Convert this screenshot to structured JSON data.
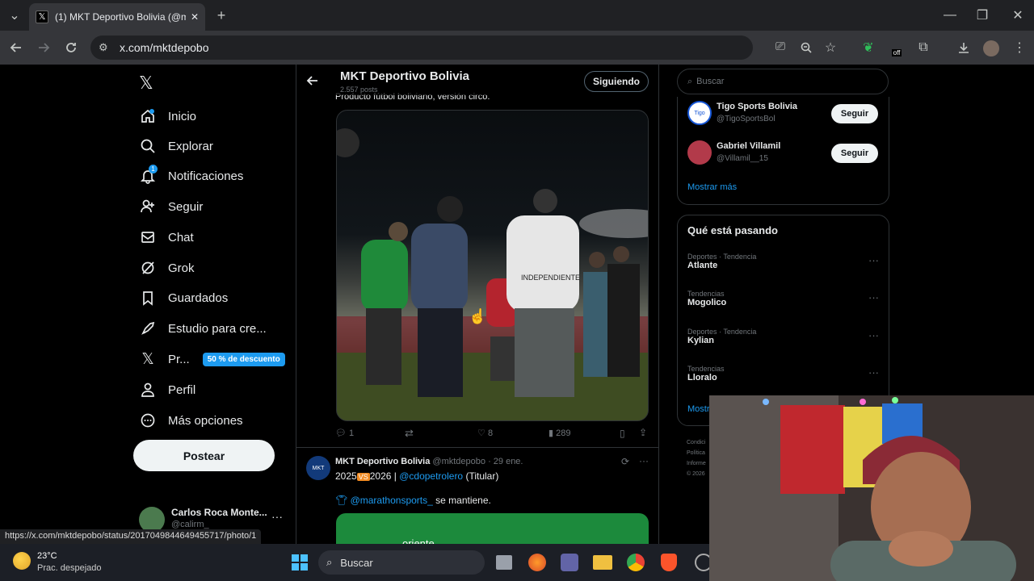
{
  "browser": {
    "tab_title": "(1) MKT Deportivo Bolivia (@mk",
    "tab_close": "✕",
    "new_tab": "+",
    "url": "x.com/mktdepobo",
    "status_url": "https://x.com/mktdepobo/status/2017049844649455717/photo/1",
    "window_min": "—",
    "window_max": "❐",
    "window_close": "✕",
    "ext_off_badge": "off"
  },
  "sidebar": {
    "items": [
      {
        "label": "Inicio"
      },
      {
        "label": "Explorar"
      },
      {
        "label": "Notificaciones"
      },
      {
        "label": "Seguir"
      },
      {
        "label": "Chat"
      },
      {
        "label": "Grok"
      },
      {
        "label": "Guardados"
      },
      {
        "label": "Estudio para cre..."
      },
      {
        "label": "Pr..."
      },
      {
        "label": "Perfil"
      },
      {
        "label": "Más opciones"
      }
    ],
    "premium_badge": "50 % de descuento",
    "notif_count": "1",
    "post_label": "Postear",
    "account_name": "Carlos Roca Monte...",
    "account_handle": "@calirm_"
  },
  "header": {
    "title": "MKT Deportivo Bolivia",
    "posts": "2.557 posts",
    "following_label": "Siguiendo",
    "cut_text": "Producto fútbol boliviano, versión circo."
  },
  "tweet1": {
    "replies": "1",
    "likes": "8",
    "views": "289",
    "jersey_text": "INDEPENDIENTE"
  },
  "tweet2": {
    "name": "MKT Deportivo Bolivia",
    "handle": "@mktdepobo",
    "date": "· 29 ene.",
    "line1_a": "2025",
    "line1_vs": "VS",
    "line1_b": "2026 |",
    "line1_mention": "@cdopetrolero",
    "line1_tail": "(Titular)",
    "line2_mention": "@marathonsports_",
    "line2_tail": "se mantiene.",
    "card_text": "oriente"
  },
  "right": {
    "search_placeholder": "Buscar",
    "suggestions": [
      {
        "name": "Tigo Sports Bolivia",
        "handle": "@TigoSportsBol",
        "button": "Seguir"
      },
      {
        "name": "Gabriel Villamil",
        "handle": "@Villamil__15",
        "button": "Seguir"
      }
    ],
    "show_more": "Mostrar más",
    "trends_title": "Qué está pasando",
    "trends": [
      {
        "category": "Deportes · Tendencia",
        "name": "Atlante"
      },
      {
        "category": "Tendencias",
        "name": "Mogolico"
      },
      {
        "category": "Deportes · Tendencia",
        "name": "Kylian"
      },
      {
        "category": "Tendencias",
        "name": "Lloralo"
      }
    ],
    "show_more_2": "Mostr",
    "footer_lines": [
      "Condici",
      "Política",
      "Informe",
      "© 2026"
    ]
  },
  "taskbar": {
    "temp": "23°C",
    "weather": "Prac. despejado",
    "search": "Buscar"
  },
  "colors": {
    "accent": "#1d9bf0",
    "bg": "#000000",
    "border": "#2f3336"
  }
}
